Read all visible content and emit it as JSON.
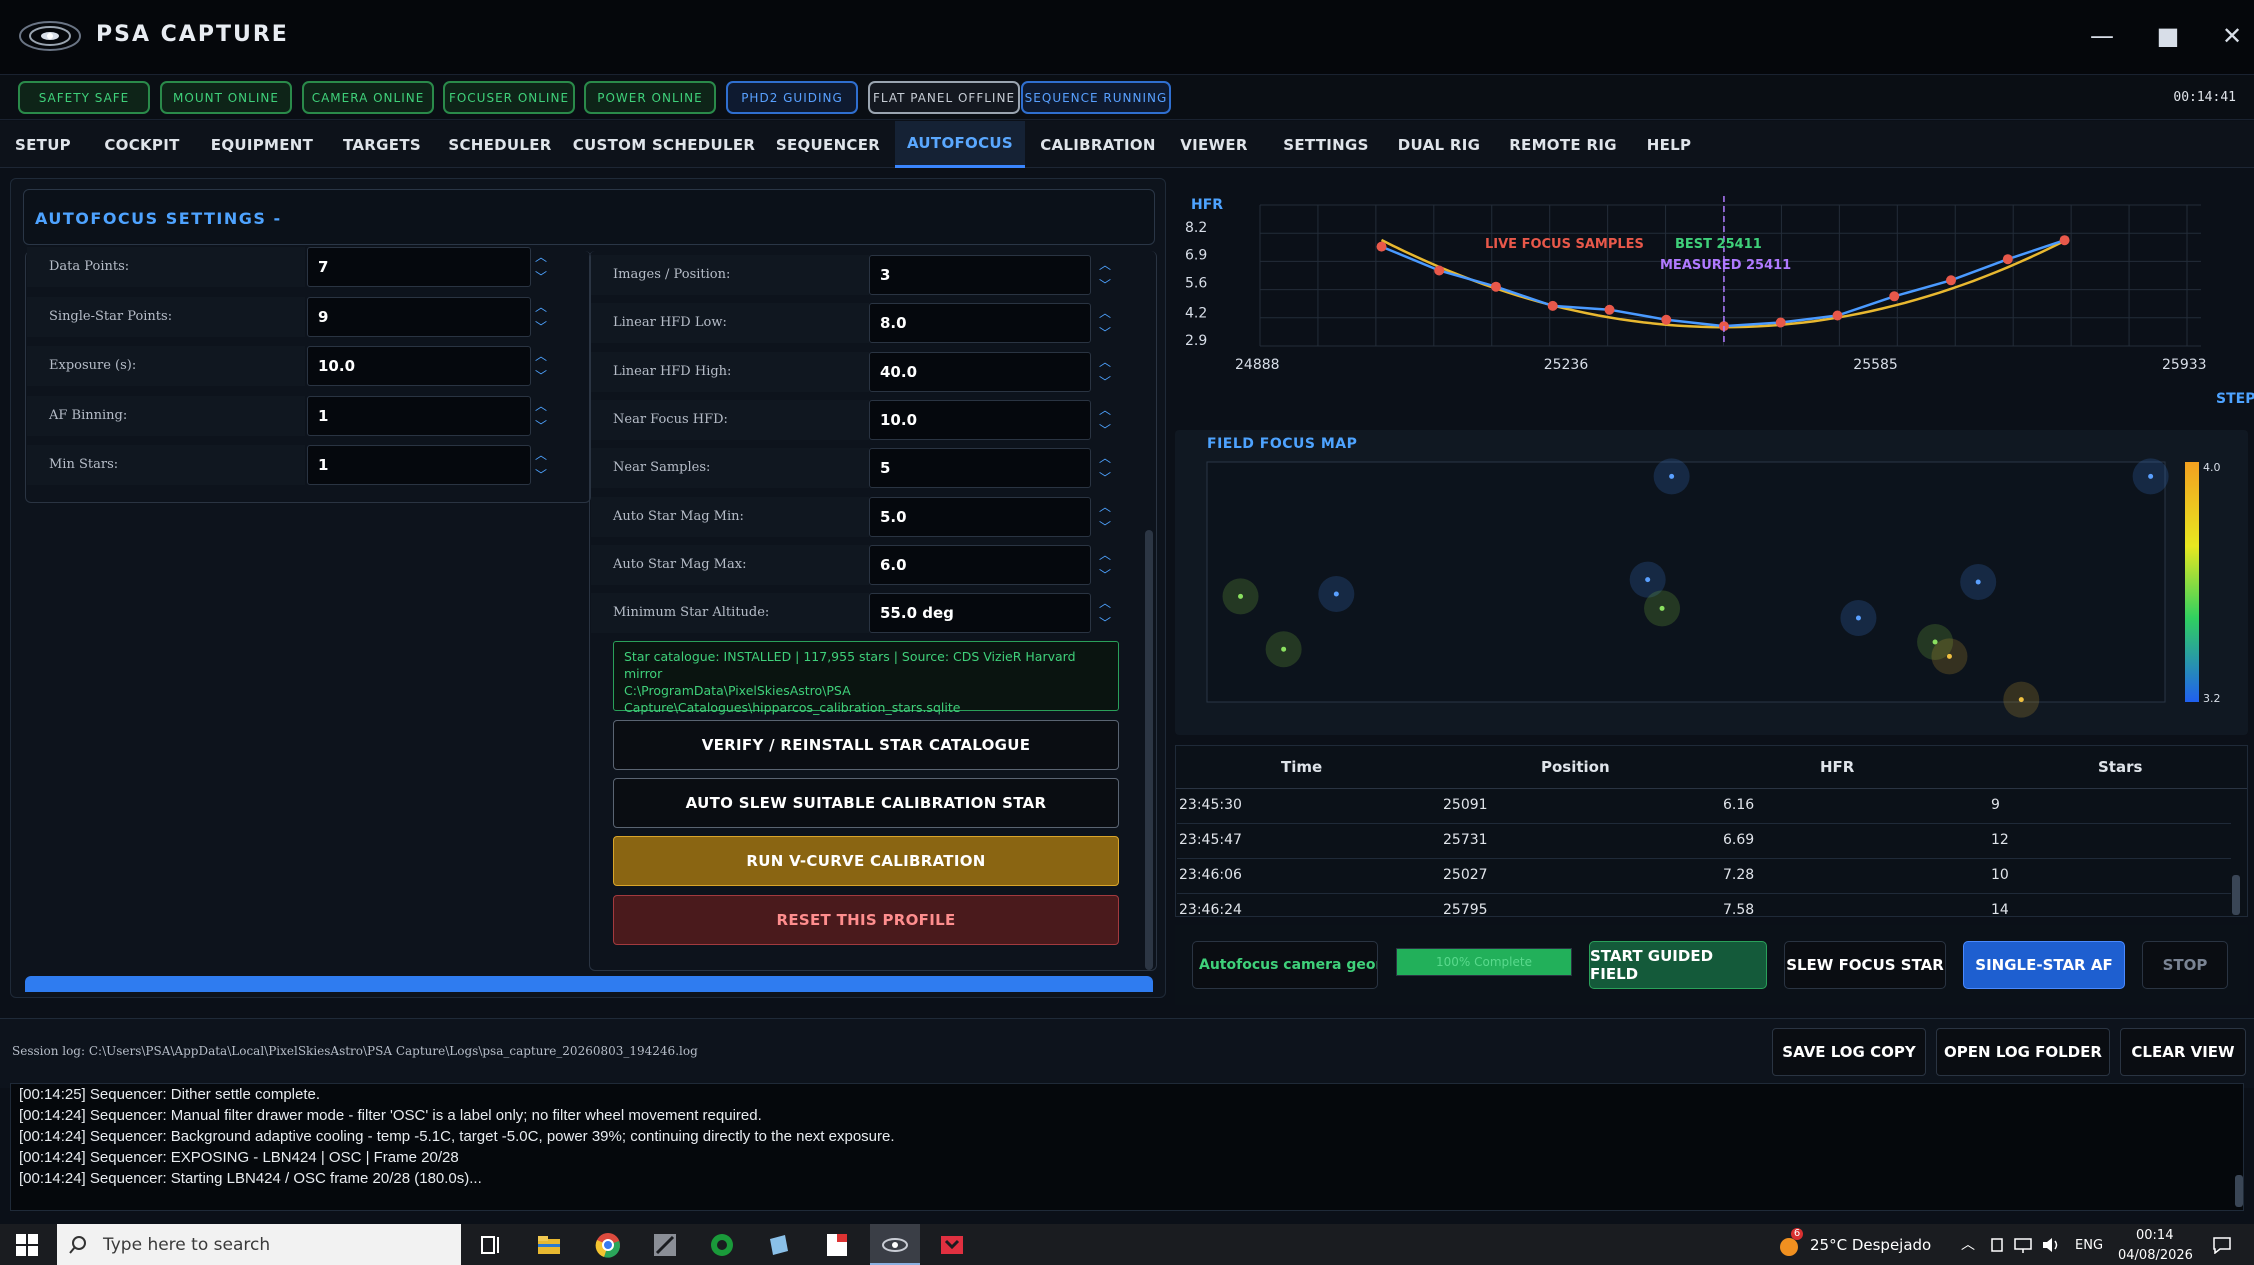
{
  "app": {
    "title": "PSA CAPTURE"
  },
  "window_controls": {
    "minimize": "—",
    "maximize": "■",
    "close": "✕"
  },
  "status_pills": [
    {
      "label": "SAFETY  SAFE",
      "style": "green"
    },
    {
      "label": "MOUNT  ONLINE",
      "style": "green"
    },
    {
      "label": "CAMERA  ONLINE",
      "style": "green"
    },
    {
      "label": "FOCUSER  ONLINE",
      "style": "green"
    },
    {
      "label": "POWER  ONLINE",
      "style": "green"
    },
    {
      "label": "PHD2  GUIDING",
      "style": "blue"
    },
    {
      "label": "FLAT PANEL  OFFLINE",
      "style": "gray"
    },
    {
      "label": "SEQUENCE  RUNNING",
      "style": "blue"
    }
  ],
  "clock": "00:14:41",
  "nav_tabs": [
    "SETUP",
    "COCKPIT",
    "EQUIPMENT",
    "TARGETS",
    "SCHEDULER",
    "CUSTOM SCHEDULER",
    "SEQUENCER",
    "AUTOFOCUS",
    "CALIBRATION",
    "VIEWER",
    "SETTINGS",
    "DUAL RIG",
    "REMOTE RIG",
    "HELP"
  ],
  "active_tab": "AUTOFOCUS",
  "autofocus": {
    "title": "AUTOFOCUS SETTINGS  -",
    "left_fields": [
      {
        "label": "Data Points:",
        "value": "7"
      },
      {
        "label": "Single-Star Points:",
        "value": "9"
      },
      {
        "label": "Exposure (s):",
        "value": "10.0"
      },
      {
        "label": "AF Binning:",
        "value": "1"
      },
      {
        "label": "Min Stars:",
        "value": "1"
      }
    ],
    "right_fields": [
      {
        "label": "Images / Position:",
        "value": "3"
      },
      {
        "label": "Linear HFD Low:",
        "value": "8.0"
      },
      {
        "label": "Linear HFD High:",
        "value": "40.0"
      },
      {
        "label": "Near Focus HFD:",
        "value": "10.0"
      },
      {
        "label": "Near Samples:",
        "value": "5"
      },
      {
        "label": "Auto Star Mag Min:",
        "value": "5.0"
      },
      {
        "label": "Auto Star Mag Max:",
        "value": "6.0"
      },
      {
        "label": "Minimum Star Altitude:",
        "value": "55.0 deg"
      }
    ],
    "catalog_info": [
      "Star catalogue: INSTALLED | 117,955 stars | Source: CDS VizieR Harvard mirror",
      "C:\\ProgramData\\PixelSkiesAstro\\PSA",
      "Capture\\Catalogues\\hipparcos_calibration_stars.sqlite"
    ],
    "buttons": {
      "verify": "VERIFY / REINSTALL STAR CATALOGUE",
      "auto_slew": "AUTO SLEW SUITABLE CALIBRATION STAR",
      "run_vcurve": "RUN V-CURVE CALIBRATION",
      "reset": "RESET THIS PROFILE"
    }
  },
  "chart_data": {
    "type": "line",
    "ylabel": "HFR",
    "xlabel": "STEP",
    "y_ticks": [
      "8.2",
      "6.9",
      "5.6",
      "4.2",
      "2.9"
    ],
    "x_ticks": [
      "24888",
      "25236",
      "25585",
      "25933"
    ],
    "ylim": [
      2.9,
      8.2
    ],
    "xlim": [
      24888,
      25933
    ],
    "series": [
      {
        "name": "LIVE FOCUS SAMPLES",
        "color": "#e8584a",
        "x": [
          25025,
          25090,
          25154,
          25218,
          25282,
          25346,
          25411,
          25475,
          25539,
          25603,
          25667,
          25731,
          25795
        ],
        "y": [
          7.28,
          6.16,
          5.4,
          4.5,
          4.32,
          3.85,
          3.55,
          3.72,
          4.05,
          4.95,
          5.7,
          6.69,
          7.58
        ]
      }
    ],
    "best_label": "BEST 25411",
    "measured_label": "MEASURED 25411",
    "best_x": 25411
  },
  "field_map": {
    "title": "FIELD FOCUS MAP",
    "scale_max": "4.0",
    "scale_min": "3.2",
    "points": [
      {
        "x": 0.485,
        "y": 0.06,
        "v": 3.35
      },
      {
        "x": 0.985,
        "y": 0.06,
        "v": 3.3
      },
      {
        "x": 0.035,
        "y": 0.56,
        "v": 3.75
      },
      {
        "x": 0.135,
        "y": 0.55,
        "v": 3.4
      },
      {
        "x": 0.46,
        "y": 0.49,
        "v": 3.4
      },
      {
        "x": 0.475,
        "y": 0.61,
        "v": 3.7
      },
      {
        "x": 0.08,
        "y": 0.78,
        "v": 3.72
      },
      {
        "x": 0.68,
        "y": 0.65,
        "v": 3.3
      },
      {
        "x": 0.805,
        "y": 0.5,
        "v": 3.35
      },
      {
        "x": 0.76,
        "y": 0.75,
        "v": 3.78
      },
      {
        "x": 0.775,
        "y": 0.81,
        "v": 3.85
      },
      {
        "x": 0.85,
        "y": 0.99,
        "v": 4.0
      }
    ]
  },
  "table": {
    "headers": [
      "Time",
      "Position",
      "HFR",
      "Stars"
    ],
    "rows": [
      [
        "23:45:30",
        "25091",
        "6.16",
        "9"
      ],
      [
        "23:45:47",
        "25731",
        "6.69",
        "12"
      ],
      [
        "23:46:06",
        "25027",
        "7.28",
        "10"
      ],
      [
        "23:46:24",
        "25795",
        "7.58",
        "14"
      ]
    ]
  },
  "actions": {
    "mode_text": "Autofocus camera geome",
    "progress_text": "100% Complete",
    "progress": 1.0,
    "start_guided": "START GUIDED FIELD",
    "slew_focus": "SLEW FOCUS STAR",
    "single_star": "SINGLE-STAR AF",
    "stop": "STOP"
  },
  "log": {
    "session_path": "Session log: C:\\Users\\PSA\\AppData\\Local\\PixelSkiesAstro\\PSA Capture\\Logs\\psa_capture_20260803_194246.log",
    "save_copy": "SAVE LOG COPY",
    "open_folder": "OPEN LOG FOLDER",
    "clear_view": "CLEAR VIEW",
    "lines": [
      "[00:14:25] Sequencer: Dither settle complete.",
      "[00:14:24] Sequencer: Manual filter drawer mode - filter 'OSC' is a label only; no filter wheel movement required.",
      "[00:14:24] Sequencer: Background adaptive cooling - temp -5.1C, target -5.0C, power 39%; continuing directly to the next exposure.",
      "[00:14:24] Sequencer: EXPOSING - LBN424 | OSC | Frame 20/28",
      "[00:14:24] Sequencer: Starting LBN424 / OSC frame 20/28 (180.0s)..."
    ]
  },
  "taskbar": {
    "search_placeholder": "Type here to search",
    "weather_badge": "6",
    "weather": "25°C  Despejado",
    "lang": "ENG",
    "time": "00:14",
    "date": "04/08/2026"
  }
}
